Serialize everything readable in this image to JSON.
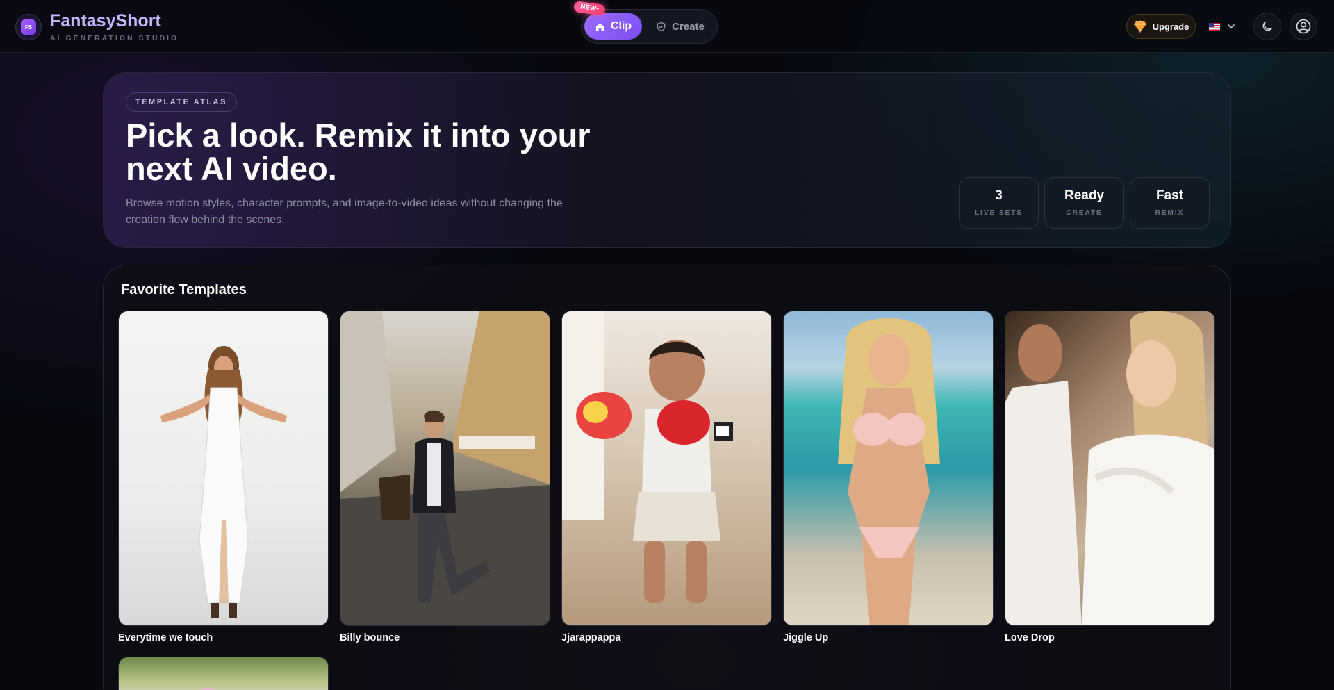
{
  "header": {
    "logo_text": "FS",
    "brand": "FantasyShort",
    "tagline": "AI GENERATION STUDIO",
    "new_badge": "NEW•",
    "modes": [
      {
        "label": "Clip",
        "icon": "home-icon",
        "active": true
      },
      {
        "label": "Create",
        "icon": "shield-check-icon",
        "active": false
      }
    ],
    "upgrade_label": "Upgrade",
    "upgrade_icon": "gem-icon",
    "language_flag": "us-flag-icon",
    "accent_color": "#8b5cf6"
  },
  "hero": {
    "tag": "TEMPLATE ATLAS",
    "title": "Pick a look. Remix it into your next AI video.",
    "description": "Browse motion styles, character prompts, and image-to-video ideas without changing the creation flow behind the scenes.",
    "stats": [
      {
        "value": "3",
        "label": "LIVE SETS"
      },
      {
        "value": "Ready",
        "label": "CREATE"
      },
      {
        "value": "Fast",
        "label": "REMIX"
      }
    ]
  },
  "favorites": {
    "title": "Favorite Templates",
    "templates": [
      {
        "name": "Everytime we touch"
      },
      {
        "name": "Billy bounce"
      },
      {
        "name": "Jjarappappa"
      },
      {
        "name": "Jiggle Up"
      },
      {
        "name": "Love Drop"
      }
    ]
  }
}
